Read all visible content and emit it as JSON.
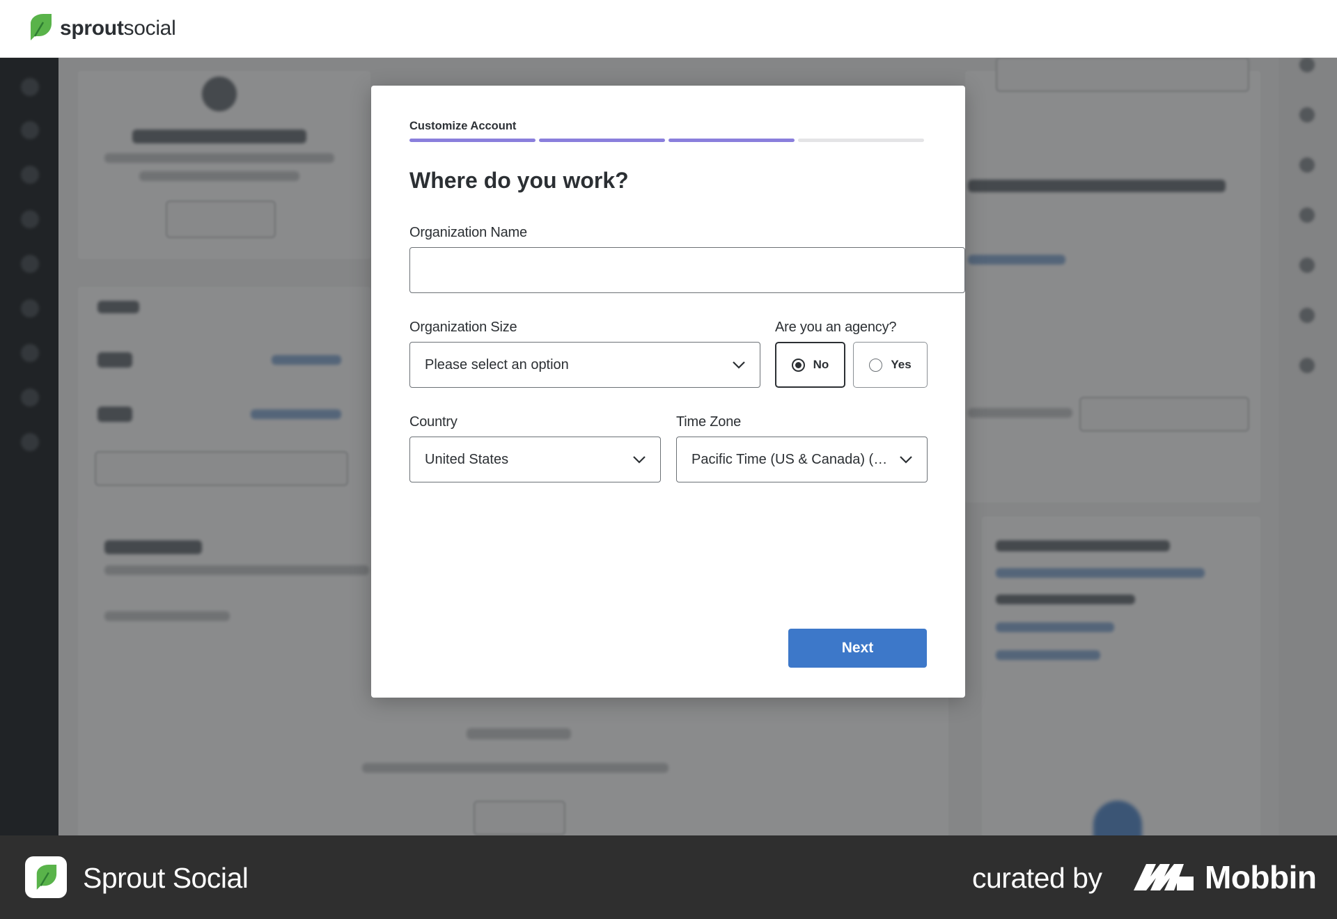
{
  "header": {
    "brand_bold": "sprout",
    "brand_light": "social"
  },
  "modal": {
    "step_label": "Customize Account",
    "progress": {
      "completed_steps": 3,
      "total_steps": 4
    },
    "title": "Where do you work?",
    "org_name": {
      "label": "Organization Name",
      "value": ""
    },
    "org_size": {
      "label": "Organization Size",
      "value": "Please select an option"
    },
    "agency": {
      "label": "Are you an agency?",
      "options": [
        {
          "label": "No",
          "selected": true
        },
        {
          "label": "Yes",
          "selected": false
        }
      ]
    },
    "country": {
      "label": "Country",
      "value": "United States"
    },
    "time_zone": {
      "label": "Time Zone",
      "value": "Pacific Time (US & Canada) (UT..."
    },
    "next_label": "Next"
  },
  "footer": {
    "app_name": "Sprout Social",
    "curated_by": "curated by",
    "mobbin": "Mobbin"
  },
  "colors": {
    "progress_done": "#8a7fdc",
    "progress_todo": "#e4e4e6",
    "primary_button": "#3d78c9",
    "brand_green": "#59b34a",
    "footer_bg": "#2f2f2f"
  }
}
